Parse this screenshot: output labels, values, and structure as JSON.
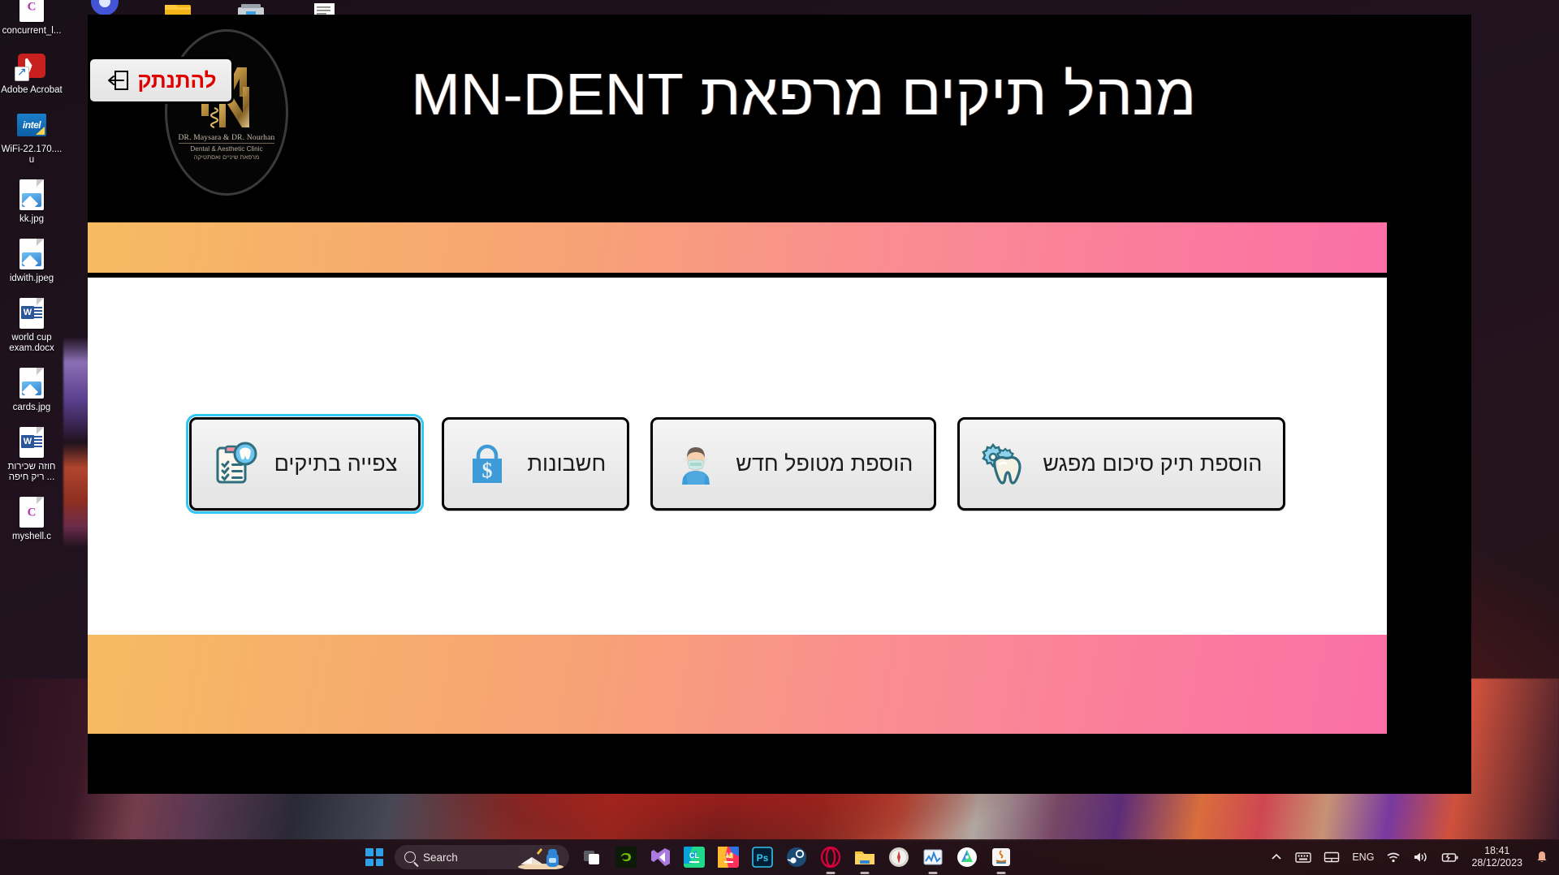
{
  "desktop": {
    "icons": [
      {
        "label": "concurrent_l...",
        "type": "c-file",
        "icon_name": "c-source-file-icon"
      },
      {
        "label": "Adobe Acrobat",
        "type": "acrobat",
        "icon_name": "adobe-acrobat-icon"
      },
      {
        "label": "WiFi-22.170.... u",
        "type": "intel",
        "icon_name": "intel-installer-icon"
      },
      {
        "label": "kk.jpg",
        "type": "image",
        "icon_name": "image-file-icon"
      },
      {
        "label": "idwith.jpeg",
        "type": "image",
        "icon_name": "image-file-icon"
      },
      {
        "label": "world cup exam.docx",
        "type": "word",
        "icon_name": "word-document-icon"
      },
      {
        "label": "cards.jpg",
        "type": "image",
        "icon_name": "image-file-icon"
      },
      {
        "label": "חוזה שכירות ריק חיפה ...",
        "type": "word",
        "icon_name": "word-document-icon"
      },
      {
        "label": "myshell.c",
        "type": "c-file",
        "icon_name": "c-source-file-icon"
      }
    ]
  },
  "app": {
    "title": "מנהל תיקים מרפאת MN-DENT",
    "logo": {
      "line1": "DR. Maysara & DR. Nourhan",
      "line2": "Dental & Aesthetic Clinic",
      "line3": "מרפאת שיניים ואסתטיקה",
      "mark": "MN"
    },
    "colors": {
      "gradient_start": "#F6BB62",
      "gradient_end": "#FB6FA6",
      "focus_ring": "#35C6F4",
      "logout_text": "#E00000",
      "icon_teal": "#2E6E7E",
      "icon_blue": "#3D9BD8"
    },
    "buttons": [
      {
        "label": "צפייה בתיקים",
        "icon_name": "clipboard-tooth-icon",
        "focused": true
      },
      {
        "label": "חשבונות",
        "icon_name": "shopping-bag-dollar-icon",
        "focused": false
      },
      {
        "label": "הוספת מטופל חדש",
        "icon_name": "masked-patient-icon",
        "focused": false
      },
      {
        "label": "הוספת תיק סיכום מפגש",
        "icon_name": "tooth-gears-icon",
        "focused": false
      }
    ],
    "logout": {
      "label": "להתנתק",
      "icon_name": "logout-arrow-icon"
    }
  },
  "taskbar": {
    "start_name": "windows-start-icon",
    "search": {
      "placeholder": "Search",
      "icon_name": "search-icon"
    },
    "apps": [
      {
        "name": "task-view-icon",
        "running": false
      },
      {
        "name": "nvidia-icon",
        "running": false
      },
      {
        "name": "visual-studio-icon",
        "running": false
      },
      {
        "name": "clion-icon",
        "running": false
      },
      {
        "name": "intellij-idea-icon",
        "running": false
      },
      {
        "name": "photoshop-icon",
        "running": false
      },
      {
        "name": "steam-icon",
        "running": false
      },
      {
        "name": "opera-icon",
        "running": true
      },
      {
        "name": "file-explorer-icon",
        "running": true
      },
      {
        "name": "compass-icon",
        "running": false
      },
      {
        "name": "performance-monitor-icon",
        "running": true
      },
      {
        "name": "android-studio-icon",
        "running": false
      },
      {
        "name": "java-icon",
        "running": true
      }
    ],
    "tray": {
      "overflow_icon": "chevron-up-icon",
      "keyboard_icon": "keyboard-icon",
      "touchpad_icon": "touchpad-icon",
      "language": "ENG",
      "wifi_icon": "wifi-icon",
      "volume_icon": "volume-icon",
      "battery_icon": "battery-charging-icon",
      "time": "18:41",
      "date": "28/12/2023",
      "notifications_icon": "notification-bell-icon"
    }
  }
}
